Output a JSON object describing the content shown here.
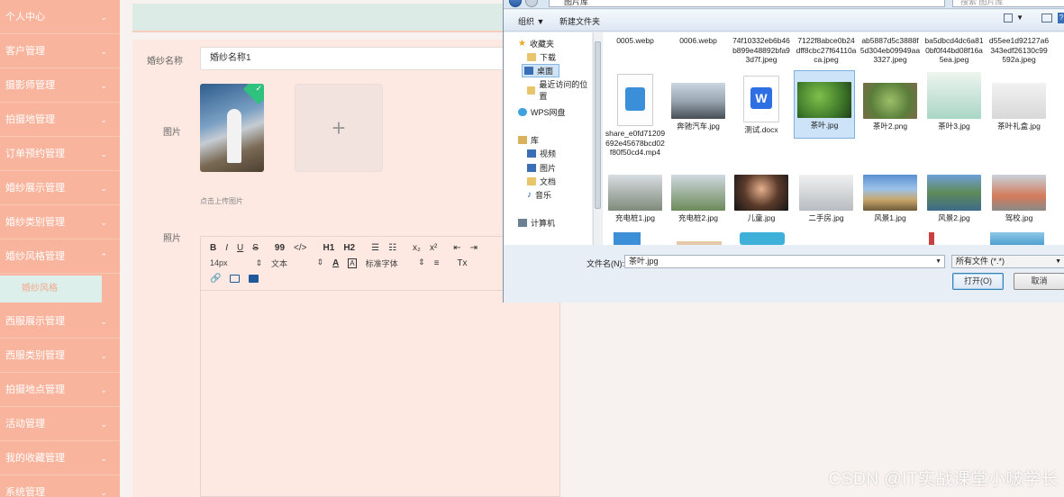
{
  "sidebar": {
    "items": [
      {
        "label": "个人中心"
      },
      {
        "label": "客户管理"
      },
      {
        "label": "摄影师管理"
      },
      {
        "label": "拍摄地管理"
      },
      {
        "label": "订单预约管理"
      },
      {
        "label": "婚纱展示管理"
      },
      {
        "label": "婚纱类别管理"
      },
      {
        "label": "婚纱风格管理"
      }
    ],
    "active_sub": "婚纱风格",
    "items_after": [
      {
        "label": "西服展示管理"
      },
      {
        "label": "西服类别管理"
      },
      {
        "label": "拍摄地点管理"
      },
      {
        "label": "活动管理"
      },
      {
        "label": "我的收藏管理"
      },
      {
        "label": "系统管理"
      }
    ]
  },
  "form": {
    "name_label": "婚纱名称",
    "name_value": "婚纱名称1",
    "image_label": "图片",
    "upload_plus": "+",
    "upload_hint": "点击上传图片",
    "photo_label": "照片"
  },
  "editor": {
    "bold": "B",
    "italic": "I",
    "underline": "U",
    "strike": "S",
    "quote": "99",
    "code": "</>",
    "h1": "H1",
    "h2": "H2",
    "sub": "x₂",
    "sup": "x²",
    "size": "14px",
    "font": "文本",
    "font_family": "标准字体",
    "clear": "Tx"
  },
  "dialog": {
    "address": "图片库",
    "search_placeholder": "搜索 图片库",
    "organize": "组织 ▼",
    "new_folder": "新建文件夹",
    "nav": {
      "favorites": "收藏夹",
      "downloads": "下载",
      "desktop": "桌面",
      "recent": "最近访问的位置",
      "wps": "WPS网盘",
      "library": "库",
      "videos": "视频",
      "pictures": "图片",
      "documents": "文档",
      "music": "音乐",
      "computer": "计算机"
    },
    "files_row0": [
      {
        "name": "0005.webp"
      },
      {
        "name": "0006.webp"
      },
      {
        "name": "74f10332eb6b46b899e48892bfa93d7f.jpeg"
      },
      {
        "name": "7122f8abce0b24dff8cbc27f64110aca.jpeg"
      },
      {
        "name": "ab5887d5c3888f5d304eb09949aa3327.jpeg"
      },
      {
        "name": "ba5dbcd4dc6a810bf0f44bd08f16a5ea.jpeg"
      },
      {
        "name": "d55ee1d92127a6343edf26130c99592a.jpeg"
      }
    ],
    "files_row1": [
      {
        "name": "share_e0fd71209692e45678bcd02f80f50cd4.mp4"
      },
      {
        "name": "奔驰汽车.jpg"
      },
      {
        "name": "测试.docx"
      },
      {
        "name": "茶叶.jpg"
      },
      {
        "name": "茶叶2.png"
      },
      {
        "name": "茶叶3.jpg"
      },
      {
        "name": "茶叶礼盒.jpg"
      }
    ],
    "files_row2": [
      {
        "name": "充电桩1.jpg"
      },
      {
        "name": "充电桩2.jpg"
      },
      {
        "name": "儿童.jpg"
      },
      {
        "name": "二手房.jpg"
      },
      {
        "name": "风景1.jpg"
      },
      {
        "name": "风景2.jpg"
      },
      {
        "name": "驾校.jpg"
      }
    ],
    "filename_label": "文件名(N):",
    "filename_value": "茶叶.jpg",
    "filetype": "所有文件 (*.*)",
    "open_button": "打开(O)",
    "cancel_button": "取消",
    "word_icon_letter": "W"
  },
  "watermark": "CSDN @IT实战课堂小啵学长",
  "colors": {
    "sidebar_bg": "#f9b49d",
    "active_sub_bg": "#dcefeb",
    "panel_bg": "#fde9e2",
    "check_badge": "#2ec27e"
  }
}
